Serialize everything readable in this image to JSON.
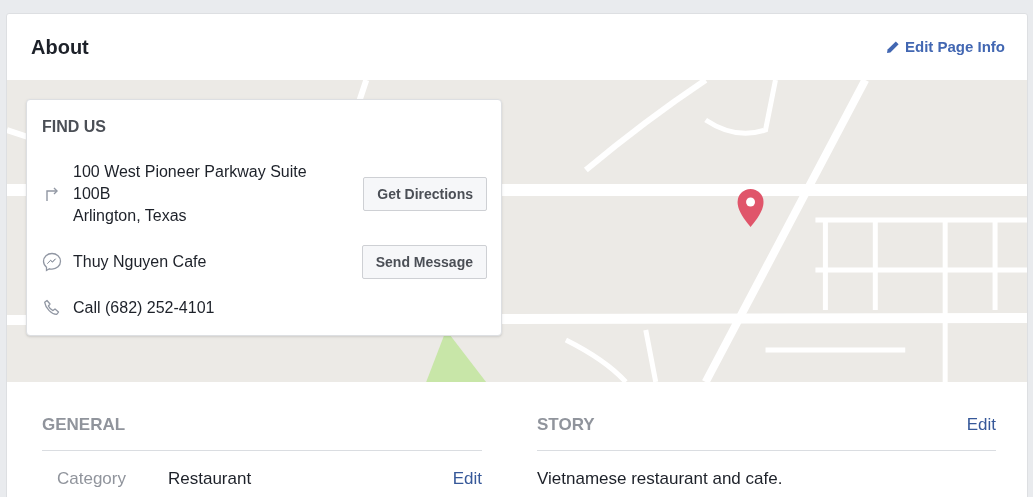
{
  "header": {
    "title": "About",
    "edit_link": "Edit Page Info"
  },
  "find_us": {
    "title": "FIND US",
    "rows": [
      {
        "kind": "directions",
        "lines": [
          "100 West Pioneer Parkway Suite 100B",
          "Arlington, Texas"
        ],
        "button": "Get Directions"
      },
      {
        "kind": "message",
        "lines": [
          "Thuy Nguyen Cafe"
        ],
        "button": "Send Message"
      },
      {
        "kind": "phone",
        "lines": [
          "Call (682) 252-4101"
        ]
      }
    ]
  },
  "general": {
    "title": "GENERAL",
    "rows": [
      {
        "label": "Category",
        "value": "Restaurant",
        "edit": "Edit"
      }
    ]
  },
  "story": {
    "title": "STORY",
    "edit": "Edit",
    "text": "Vietnamese restaurant and cafe."
  }
}
